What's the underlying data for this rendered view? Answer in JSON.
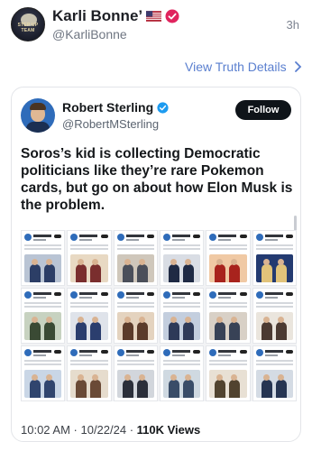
{
  "post": {
    "author_name": "Karli Bonne’",
    "handle": "@KarliBonne",
    "time_ago": "3h",
    "avatar_text": "STEP UP TEAM",
    "flag_icon": "us-flag-icon",
    "verified_icon": "verified-badge-icon",
    "view_details_label": "View Truth Details"
  },
  "quote": {
    "author_name": "Robert Sterling",
    "handle": "@RobertMSterling",
    "follow_label": "Follow",
    "text": "Soros’s kid is collecting Democratic politicians like they’re rare Pokemon cards, but go on about how Elon Musk is the problem.",
    "time": "10:02 AM · 10/22/24 · ",
    "views": "110K Views",
    "grid_count": 18
  },
  "colors": {
    "link": "#5a7fcf",
    "verified_blue": "#1d9bf0",
    "verified_pink": "#e0245e",
    "follow_bg": "#0f1419"
  }
}
